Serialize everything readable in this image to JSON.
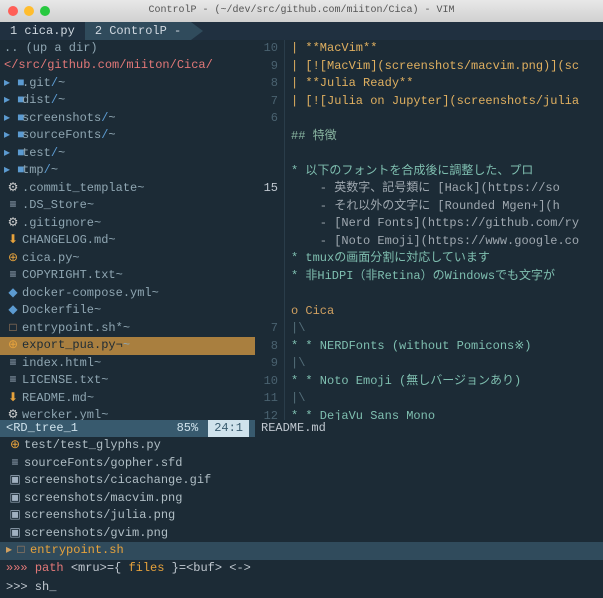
{
  "title": "ControlP - (~/dev/src/github.com/miiton/Cica) - VIM",
  "tabs": [
    {
      "label": "1 cica.py",
      "active": false
    },
    {
      "label": "2 ControlP -",
      "active": true
    }
  ],
  "tree": {
    "up": ".. (up a dir)",
    "root": "</src/github.com/miiton/Cica/",
    "items": [
      {
        "icon": "folder",
        "name": ".git/",
        "dir": true
      },
      {
        "icon": "folder",
        "name": "dist/",
        "dir": true
      },
      {
        "icon": "folder",
        "name": "screenshots/",
        "dir": true
      },
      {
        "icon": "folder",
        "name": "sourceFonts/",
        "dir": true
      },
      {
        "icon": "folder",
        "name": "test/",
        "dir": true
      },
      {
        "icon": "folder",
        "name": "tmp/",
        "dir": true
      },
      {
        "icon": "gear",
        "name": ".commit_template"
      },
      {
        "icon": "doc",
        "name": ".DS_Store"
      },
      {
        "icon": "gear",
        "name": ".gitignore"
      },
      {
        "icon": "down",
        "name": "CHANGELOG.md"
      },
      {
        "icon": "py",
        "name": "cica.py"
      },
      {
        "icon": "doc",
        "name": "COPYRIGHT.txt"
      },
      {
        "icon": "whale",
        "name": "docker-compose.yml"
      },
      {
        "icon": "whale",
        "name": "Dockerfile"
      },
      {
        "icon": "sh",
        "name": "entrypoint.sh*"
      },
      {
        "icon": "py",
        "name": "export_pua.py¬",
        "selected": true
      },
      {
        "icon": "doc",
        "name": "index.html"
      },
      {
        "icon": "doc",
        "name": "LICENSE.txt"
      },
      {
        "icon": "down",
        "name": "README.md"
      },
      {
        "icon": "gear",
        "name": "wercker.yml"
      }
    ],
    "status": {
      "name": "<RD_tree_1",
      "pct": "85%",
      "pos": "24:1"
    }
  },
  "editor": {
    "gutter": [
      "10",
      "9",
      "8",
      "7",
      "6",
      "",
      "",
      "",
      "15",
      "",
      "",
      "",
      "",
      "",
      "",
      "",
      "7",
      "8",
      "9",
      "10",
      "11",
      "12"
    ],
    "gutter_current_index": 8,
    "lines": [
      {
        "t": "| **MacVim**",
        "cls": "c-yellow"
      },
      {
        "t": "| [![MacVim](screenshots/macvim.png)](sc",
        "cls": "c-yellow"
      },
      {
        "t": "| **Julia Ready**",
        "cls": "c-yellow"
      },
      {
        "t": "| [![Julia on Jupyter](screenshots/julia",
        "cls": "c-yellow"
      },
      {
        "t": "",
        "cls": ""
      },
      {
        "t": "## 特徴",
        "cls": "c-cn"
      },
      {
        "t": "",
        "cls": ""
      },
      {
        "t": "* 以下のフォントを合成後に調整した、プロ",
        "cls": "c-teal"
      },
      {
        "t": "    - 英数字、記号類に [Hack](https://so",
        "cls": "c-link"
      },
      {
        "t": "    - それ以外の文字に [Rounded Mgen+](h",
        "cls": "c-link"
      },
      {
        "t": "    - [Nerd Fonts](https://github.com/ry",
        "cls": "c-link"
      },
      {
        "t": "    - [Noto Emoji](https://www.google.co",
        "cls": "c-link"
      },
      {
        "t": "* tmuxの画面分割に対応しています",
        "cls": "c-teal"
      },
      {
        "t": "* 非HiDPI（非Retina）のWindowsでも文字が",
        "cls": "c-teal"
      },
      {
        "t": "",
        "cls": ""
      },
      {
        "t": "o Cica",
        "cls": "c-o"
      },
      {
        "t": "|\\",
        "cls": "c-dim"
      },
      {
        "t": "* * NERDFonts (without Pomicons※)",
        "cls": "c-teal"
      },
      {
        "t": "|\\",
        "cls": "c-dim"
      },
      {
        "t": "* * Noto Emoji (無しバージョンあり)",
        "cls": "c-teal"
      },
      {
        "t": "|\\",
        "cls": "c-dim"
      },
      {
        "t": "* * DejaVu Sans Mono",
        "cls": "c-teal"
      }
    ],
    "status": "README.md"
  },
  "ctrlp": {
    "items": [
      {
        "icon": "py",
        "name": "test/test_glyphs.py"
      },
      {
        "icon": "doc",
        "name": "sourceFonts/gopher.sfd"
      },
      {
        "icon": "img",
        "name": "screenshots/cicachange.gif"
      },
      {
        "icon": "img",
        "name": "screenshots/macvim.png"
      },
      {
        "icon": "img",
        "name": "screenshots/julia.png"
      },
      {
        "icon": "img",
        "name": "screenshots/gvim.png"
      },
      {
        "icon": "sh",
        "name": "entrypoint.sh",
        "selected": true
      }
    ],
    "status": "»»» path <mru>={ files }=<buf> <->",
    "prompt": ">>> sh_"
  }
}
